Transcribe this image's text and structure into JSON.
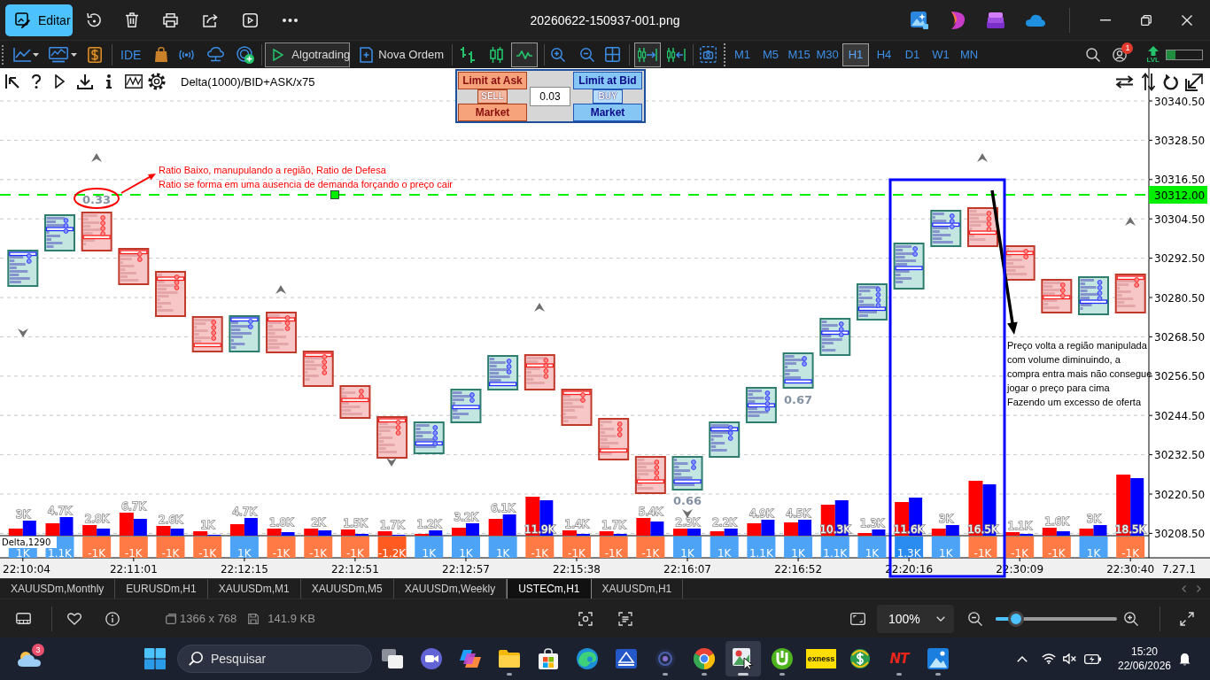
{
  "viewer": {
    "edit_button": "Editar",
    "title": "20260622-150937-001.png",
    "dimensions": "1366 x 768",
    "file_size": "141.9 KB",
    "zoom": "100%",
    "zoom_slider": {
      "level": 0.17
    }
  },
  "terminal": {
    "toolbar": {
      "ide": "IDE",
      "algotrading": "Algotrading",
      "new_order": "Nova Ordem",
      "chart_types": [
        {
          "kind": "bars",
          "selected": false
        },
        {
          "kind": "candles",
          "selected": false
        },
        {
          "kind": "line",
          "selected": true
        }
      ],
      "toggles": [
        {
          "kind": "autoscroll",
          "on": true
        },
        {
          "kind": "shift",
          "on": false
        }
      ],
      "timeframes": [
        {
          "label": "M1",
          "selected": false
        },
        {
          "label": "M5",
          "selected": false
        },
        {
          "label": "M15",
          "selected": false
        },
        {
          "label": "M30",
          "selected": false
        },
        {
          "label": "H1",
          "selected": true
        },
        {
          "label": "H4",
          "selected": false
        },
        {
          "label": "D1",
          "selected": false
        },
        {
          "label": "W1",
          "selected": false
        },
        {
          "label": "MN",
          "selected": false
        }
      ],
      "notification_count": "1",
      "level_badge": "LVL",
      "meter": {
        "level": 0.25
      }
    },
    "chart": {
      "indicator": "Delta(1000)/BID+ASK/x75",
      "trade_panel": {
        "sell_limit": "Limit at Ask",
        "sell": "SELL",
        "sell_market": "Market",
        "volume": "0.03",
        "buy_limit": "Limit at Bid",
        "buy": "BUY",
        "buy_market": "Market"
      },
      "price_axis": [
        "30340.50",
        "30328.50",
        "30316.50",
        "30304.50",
        "30292.50",
        "30280.50",
        "30268.50",
        "30256.50",
        "30244.50",
        "30232.50",
        "30220.50",
        "30208.50"
      ],
      "price_line": {
        "label": "30312.00"
      },
      "candles": [
        {
          "kind": "bull"
        },
        {
          "kind": "bull"
        },
        {
          "kind": "bear"
        },
        {
          "kind": "bear"
        },
        {
          "kind": "bear"
        },
        {
          "kind": "bear"
        },
        {
          "kind": "bull"
        },
        {
          "kind": "bear"
        },
        {
          "kind": "bear"
        },
        {
          "kind": "bear"
        },
        {
          "kind": "bear"
        },
        {
          "kind": "bull"
        },
        {
          "kind": "bull"
        },
        {
          "kind": "bull"
        },
        {
          "kind": "bear"
        },
        {
          "kind": "bear"
        },
        {
          "kind": "bear"
        },
        {
          "kind": "bear"
        },
        {
          "kind": "bull"
        },
        {
          "kind": "bull"
        },
        {
          "kind": "bull"
        },
        {
          "kind": "bull"
        },
        {
          "kind": "bull"
        },
        {
          "kind": "bull"
        },
        {
          "kind": "bull"
        },
        {
          "kind": "bull"
        },
        {
          "kind": "bear"
        },
        {
          "kind": "bear"
        },
        {
          "kind": "bear"
        },
        {
          "kind": "bull"
        },
        {
          "kind": "bear"
        }
      ],
      "ratio_labels": [
        "0.33",
        "0.67",
        "0.66"
      ],
      "notes": [
        {
          "color": "#ff0000",
          "lines": [
            "Ratio Baixo, manupulando a região, Ratio de Defesa",
            "Ratio se forma em uma ausencia de demanda forçando o preço cair"
          ]
        },
        {
          "color": "#000000",
          "lines": [
            "Preço volta a região manipulada",
            "com volume diminuindo, a",
            "compra entra mais não consegue",
            "jogar o preço para cima",
            "Fazendo um excesso de oferta"
          ]
        }
      ],
      "drawings": [
        {
          "kind": "ellipse",
          "color": "#ff0000"
        },
        {
          "kind": "arrow",
          "color": "#ff0000"
        },
        {
          "kind": "arrow",
          "color": "#000000"
        },
        {
          "kind": "rectangle",
          "color": "#0000ff"
        },
        {
          "kind": "marker_up"
        },
        {
          "kind": "marker_up"
        },
        {
          "kind": "marker_up"
        },
        {
          "kind": "marker_up"
        },
        {
          "kind": "marker_up"
        },
        {
          "kind": "marker_down"
        },
        {
          "kind": "marker_down"
        },
        {
          "kind": "marker_down"
        }
      ],
      "volume": {
        "bars": [
          {
            "label": "3K"
          },
          {
            "label": "4.7K"
          },
          {
            "label": "2.8K"
          },
          {
            "label": "6.7K"
          },
          {
            "label": "2.6K"
          },
          {
            "label": "1K"
          },
          {
            "label": "4.7K"
          },
          {
            "label": "1.8K"
          },
          {
            "label": "2K"
          },
          {
            "label": "1.5K"
          },
          {
            "label": "1.7K"
          },
          {
            "label": "1.2K"
          },
          {
            "label": "3.2K"
          },
          {
            "label": "6.1K"
          },
          {
            "label": "11.9K"
          },
          {
            "label": "1.4K"
          },
          {
            "label": "1.7K"
          },
          {
            "label": "5.4K"
          },
          {
            "label": "2.3K"
          },
          {
            "label": "2.2K"
          },
          {
            "label": "4.9K"
          },
          {
            "label": "4.5K"
          },
          {
            "label": "10.3K"
          },
          {
            "label": "1.3K"
          },
          {
            "label": "11.6K"
          },
          {
            "label": "3K"
          },
          {
            "label": "16.5K"
          },
          {
            "label": "1.1K"
          },
          {
            "label": "1.6K"
          },
          {
            "label": "3K"
          },
          {
            "label": "18.5K"
          }
        ]
      },
      "delta": {
        "label": "Delta,1290",
        "bars": [
          {
            "label": "1K",
            "color": "#4da3f5"
          },
          {
            "label": "1.1K",
            "color": "#4da3f5"
          },
          {
            "label": "-1K",
            "color": "#ff7a45"
          },
          {
            "label": "-1K",
            "color": "#ff7a45"
          },
          {
            "label": "-1K",
            "color": "#ff7a45"
          },
          {
            "label": "-1K",
            "color": "#ff7a45"
          },
          {
            "label": "1K",
            "color": "#4da3f5"
          },
          {
            "label": "-1K",
            "color": "#ff7a45"
          },
          {
            "label": "-1K",
            "color": "#ff7a45"
          },
          {
            "label": "-1K",
            "color": "#ff7a45"
          },
          {
            "label": "-1.2K",
            "color": "#ff5a1f"
          },
          {
            "label": "1K",
            "color": "#4da3f5"
          },
          {
            "label": "1K",
            "color": "#4da3f5"
          },
          {
            "label": "1K",
            "color": "#4da3f5"
          },
          {
            "label": "-1K",
            "color": "#ff7a45"
          },
          {
            "label": "-1K",
            "color": "#ff7a45"
          },
          {
            "label": "-1K",
            "color": "#ff7a45"
          },
          {
            "label": "-1K",
            "color": "#ff7a45"
          },
          {
            "label": "1K",
            "color": "#4da3f5"
          },
          {
            "label": "1K",
            "color": "#4da3f5"
          },
          {
            "label": "1.1K",
            "color": "#4da3f5"
          },
          {
            "label": "1K",
            "color": "#4da3f5"
          },
          {
            "label": "1.1K",
            "color": "#4da3f5"
          },
          {
            "label": "1K",
            "color": "#4da3f5"
          },
          {
            "label": "1.3K",
            "color": "#2a8cf0"
          },
          {
            "label": "1K",
            "color": "#4da3f5"
          },
          {
            "label": "-1K",
            "color": "#ff7a45"
          },
          {
            "label": "-1K",
            "color": "#ff7a45"
          },
          {
            "label": "-1K",
            "color": "#ff7a45"
          },
          {
            "label": "1K",
            "color": "#4da3f5"
          },
          {
            "label": "-1K",
            "color": "#ff7a45"
          }
        ]
      },
      "time_axis": [
        "22:10:04",
        "22:11:01",
        "22:12:15",
        "22:12:51",
        "22:12:57",
        "22:15:38",
        "22:16:07",
        "22:16:52",
        "22:20:16",
        "22:30:09",
        "22:30:40"
      ],
      "corner_label": "7.27.1"
    },
    "tabs": [
      {
        "label": "XAUUSDm,Monthly",
        "selected": false
      },
      {
        "label": "EURUSDm,H1",
        "selected": false
      },
      {
        "label": "XAUUSDm,M1",
        "selected": false
      },
      {
        "label": "XAUUSDm,M5",
        "selected": false
      },
      {
        "label": "XAUUSDm,Weekly",
        "selected": false
      },
      {
        "label": "USTECm,H1",
        "selected": true
      },
      {
        "label": "XAUUSDm,H1",
        "selected": false
      }
    ]
  },
  "taskbar": {
    "weather_badge": "3",
    "search": {
      "placeholder": "Pesquisar"
    },
    "apps": [
      {
        "kind": "task_view",
        "running": false,
        "selected": false
      },
      {
        "kind": "video_call",
        "running": false,
        "selected": false
      },
      {
        "kind": "assistant",
        "running": false,
        "selected": false
      },
      {
        "kind": "folder",
        "running": true,
        "selected": false
      },
      {
        "kind": "store",
        "running": false,
        "selected": false
      },
      {
        "kind": "browser_wave",
        "running": false,
        "selected": false
      },
      {
        "kind": "scanner",
        "running": false,
        "selected": false
      },
      {
        "kind": "orb",
        "running": true,
        "selected": false
      },
      {
        "kind": "browser_circle",
        "running": true,
        "selected": false
      },
      {
        "kind": "paint",
        "running": true,
        "selected": true
      },
      {
        "kind": "torrent",
        "running": true,
        "selected": false
      },
      {
        "kind": "tile_logo",
        "label": "exness",
        "running": false,
        "selected": false
      },
      {
        "kind": "trading",
        "running": false,
        "selected": false
      },
      {
        "kind": "letter_logo",
        "label": "NT",
        "running": true,
        "selected": false
      },
      {
        "kind": "photos",
        "running": true,
        "selected": false
      }
    ],
    "time": "15:20",
    "date": "22/06/2026"
  }
}
